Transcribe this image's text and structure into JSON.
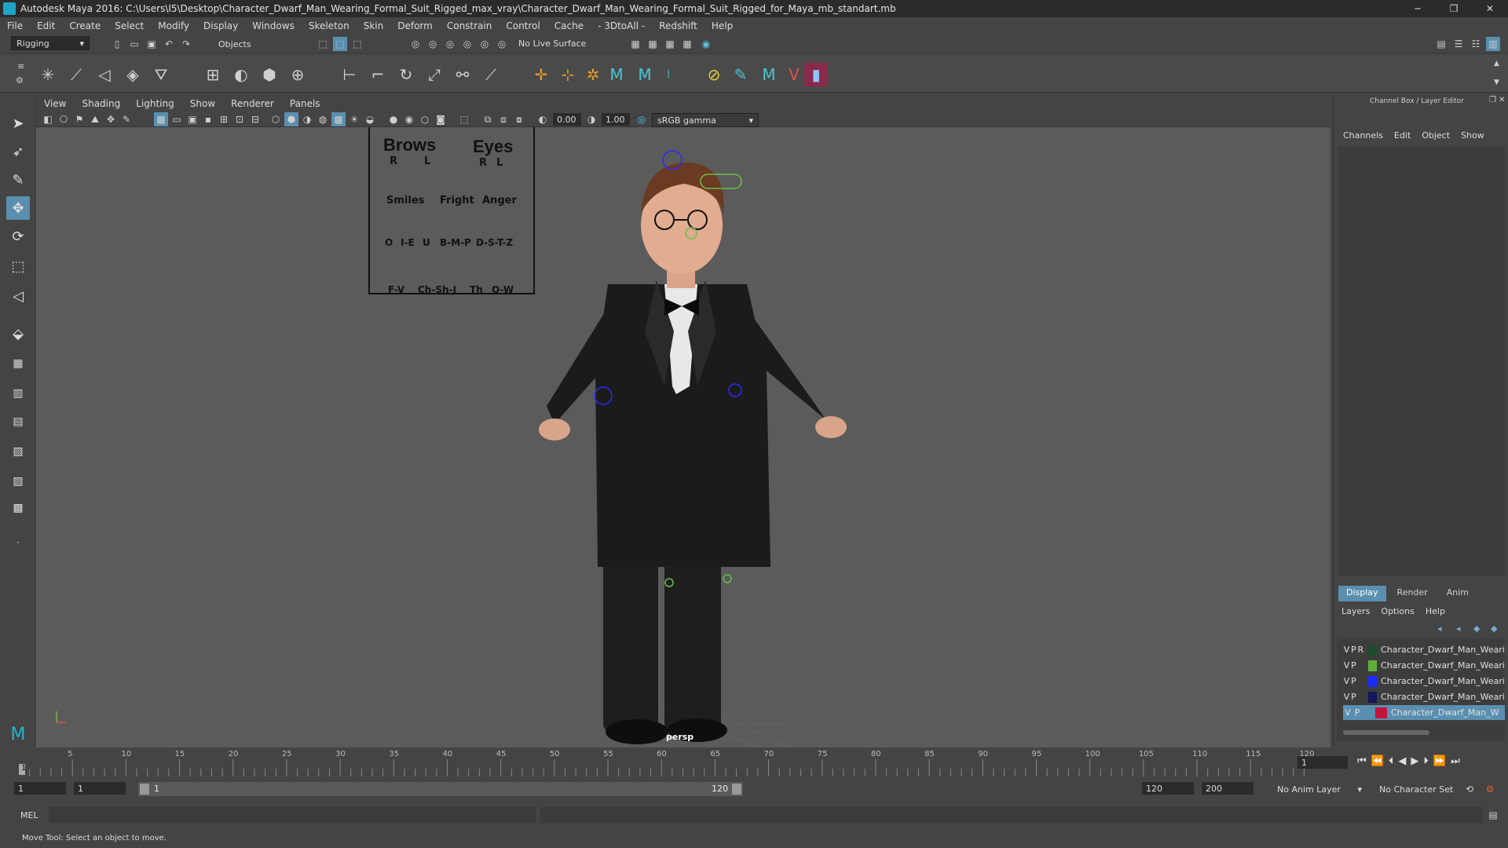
{
  "titlebar": {
    "title": "Autodesk Maya 2016: C:\\Users\\I5\\Desktop\\Character_Dwarf_Man_Wearing_Formal_Suit_Rigged_max_vray\\Character_Dwarf_Man_Wearing_Formal_Suit_Rigged_for_Maya_mb_standart.mb",
    "minimize": "─",
    "maximize": "❐",
    "close": "✕"
  },
  "menubar": [
    "File",
    "Edit",
    "Create",
    "Select",
    "Modify",
    "Display",
    "Windows",
    "Skeleton",
    "Skin",
    "Deform",
    "Constrain",
    "Control",
    "Cache",
    "- 3DtoAll -",
    "Redshift",
    "Help"
  ],
  "statusline": {
    "menuset": "Rigging",
    "selection_mode": "Objects",
    "live_surface": "No Live Surface"
  },
  "viewport_menu": [
    "View",
    "Shading",
    "Lighting",
    "Show",
    "Renderer",
    "Panels"
  ],
  "viewport_tools": {
    "field1": "0.00",
    "field2": "1.00",
    "colorspace": "sRGB gamma"
  },
  "viewport": {
    "camera_label": "persp",
    "facial_board": {
      "headers": [
        "Brows",
        "Eyes"
      ],
      "brows_rl": [
        "R",
        "L"
      ],
      "eyes_rl": [
        "R",
        "L"
      ],
      "row2": [
        "Smiles",
        "Fright",
        "Anger"
      ],
      "row3": [
        "O",
        "I-E",
        "U",
        "B-M-P",
        "D-S-T-Z"
      ],
      "row4": [
        "F-V",
        "Ch-Sh-J",
        "Th",
        "Q-W"
      ]
    }
  },
  "channel_box": {
    "header": "Channel Box / Layer Editor",
    "menu": [
      "Channels",
      "Edit",
      "Object",
      "Show"
    ]
  },
  "layer_editor": {
    "tabs": [
      "Display",
      "Render",
      "Anim"
    ],
    "menu": [
      "Layers",
      "Options",
      "Help"
    ],
    "layers": [
      {
        "v": "V",
        "p": "P",
        "r": "R",
        "color": "#1d4a2a",
        "name": "Character_Dwarf_Man_Weari"
      },
      {
        "v": "V",
        "p": "P",
        "r": "",
        "color": "#5fae3a",
        "name": "Character_Dwarf_Man_Weari"
      },
      {
        "v": "V",
        "p": "P",
        "r": "",
        "color": "#1a2cff",
        "name": "Character_Dwarf_Man_Weari"
      },
      {
        "v": "V",
        "p": "P",
        "r": "",
        "color": "#12175e",
        "name": "Character_Dwarf_Man_Weari"
      },
      {
        "v": "V",
        "p": "P",
        "r": "",
        "color": "#c2133a",
        "name": "Character_Dwarf_Man_W"
      }
    ]
  },
  "timeline": {
    "ticks": [
      "5",
      "10",
      "15",
      "20",
      "25",
      "30",
      "35",
      "40",
      "45",
      "50",
      "55",
      "60",
      "65",
      "70",
      "75",
      "80",
      "85",
      "90",
      "95",
      "100",
      "105",
      "110",
      "115",
      "120"
    ],
    "start_label": "1",
    "current_frame": "1"
  },
  "range": {
    "start": "1",
    "playback_start": "1",
    "slider_start": "1",
    "slider_end": "120",
    "playback_end": "120",
    "end": "200",
    "anim_layer": "No Anim Layer",
    "character_set": "No Character Set"
  },
  "cmdline": {
    "label": "MEL"
  },
  "helpline": {
    "text": "Move Tool: Select an object to move."
  }
}
